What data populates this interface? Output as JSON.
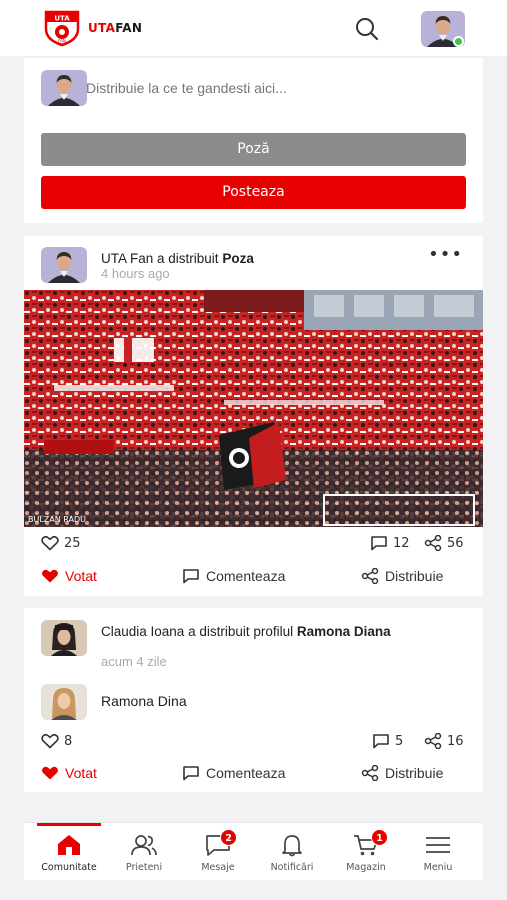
{
  "header": {
    "logo_text": "UTA",
    "logo_sub": "FAN",
    "brand_red": "UTA",
    "brand_dark": "FAN",
    "accent": "#e60000"
  },
  "composer": {
    "placeholder": "Distribuie la ce te gandesti aici...",
    "photo_label": "Poză",
    "post_label": "Posteaza"
  },
  "posts": [
    {
      "author": "UTA Fan",
      "action_text": " a distribuit ",
      "object": "Poza",
      "time": "4 hours ago",
      "photo_credit": "BULZAN RADU",
      "likes": "25",
      "comments": "12",
      "shares": "56",
      "voted_label": "Votat",
      "comment_label": "Comenteaza",
      "share_label": "Distribuie"
    },
    {
      "author": "Claudia Ioana",
      "action_text": " a distribuit profilul ",
      "object": "Ramona Diana",
      "time": "acum 4 zile",
      "shared_profile_name": "Ramona Dina",
      "likes": "8",
      "comments": "5",
      "shares": "16",
      "voted_label": "Votat",
      "comment_label": "Comenteaza",
      "share_label": "Distribuie"
    }
  ],
  "nav": {
    "tabs": [
      {
        "label": "Comunitate",
        "icon": "home-icon",
        "active": true
      },
      {
        "label": "Prieteni",
        "icon": "friends-icon"
      },
      {
        "label": "Mesaje",
        "icon": "message-icon",
        "badge": "2"
      },
      {
        "label": "Notificări",
        "icon": "bell-icon"
      },
      {
        "label": "Magazin",
        "icon": "cart-icon",
        "badge": "1"
      },
      {
        "label": "Meniu",
        "icon": "menu-icon"
      }
    ]
  }
}
